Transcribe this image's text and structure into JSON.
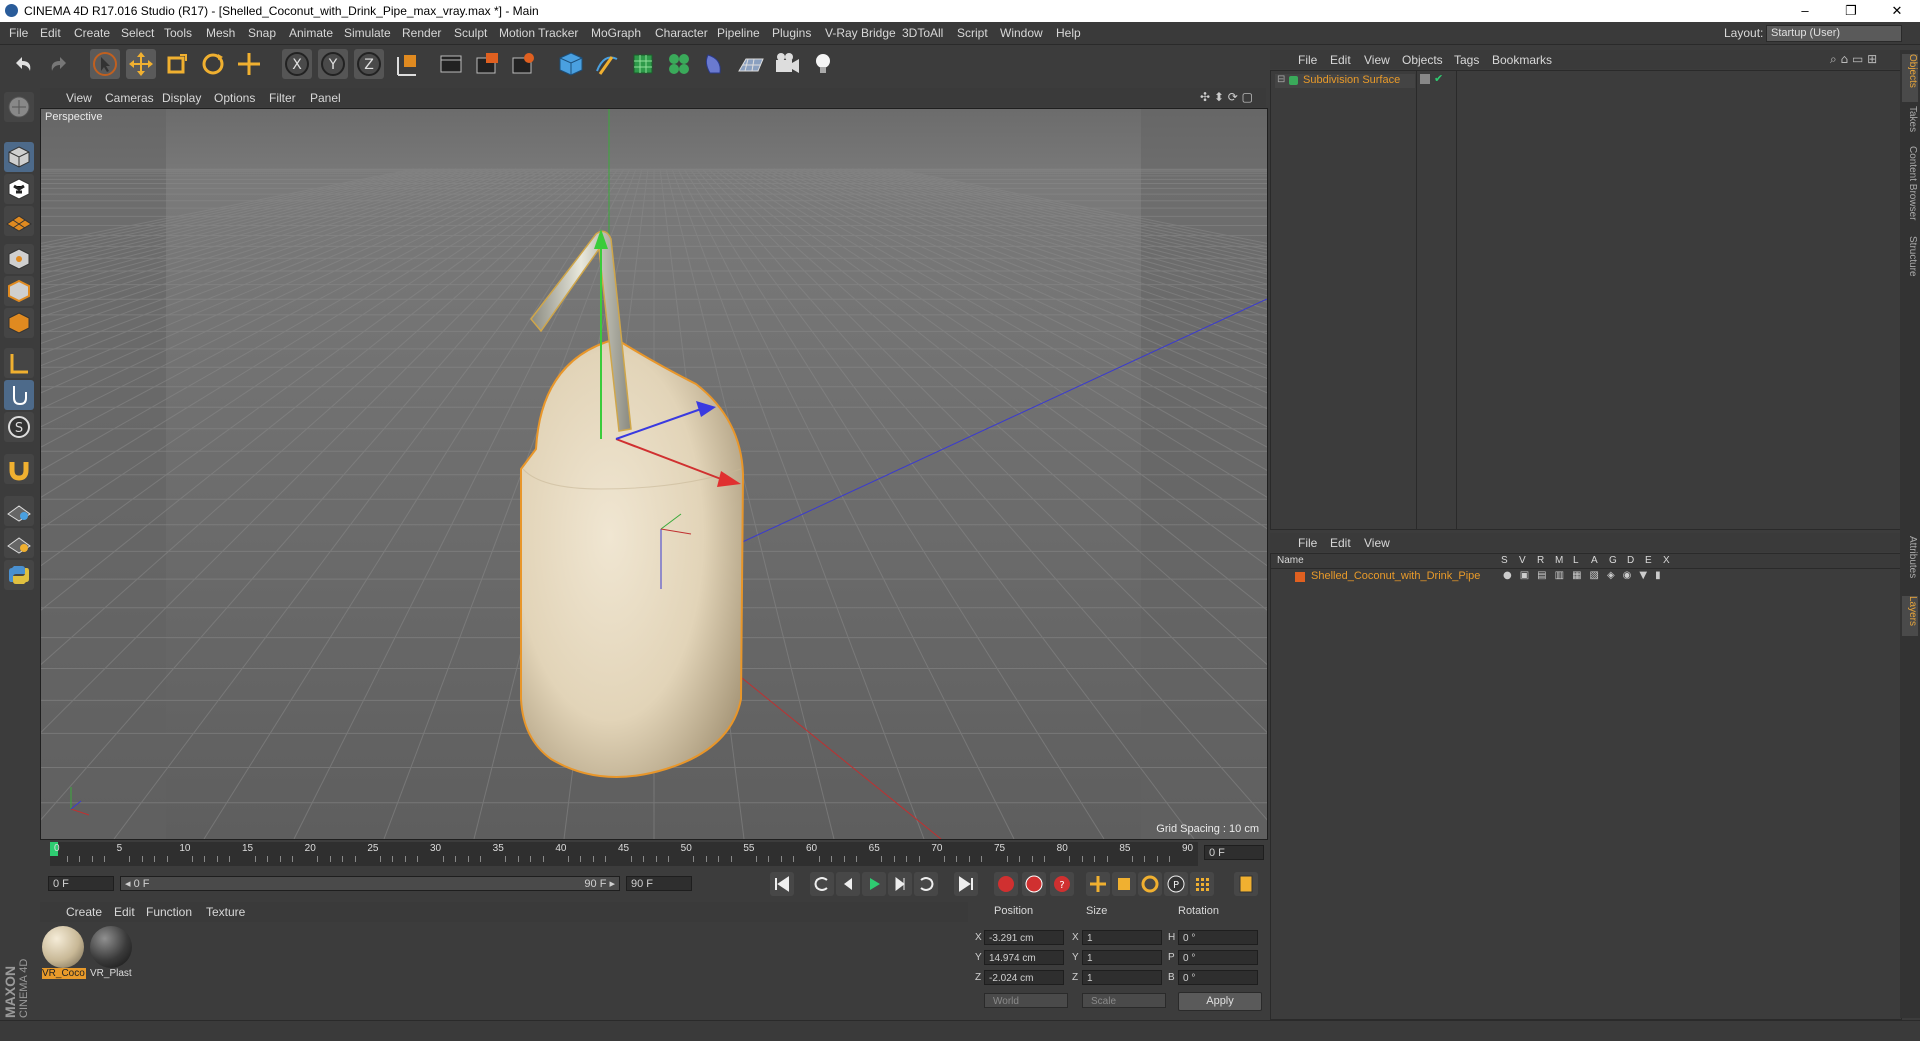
{
  "window": {
    "title": "CINEMA 4D R17.016 Studio (R17) - [Shelled_Coconut_with_Drink_Pipe_max_vray.max *] - Main",
    "minimize": "–",
    "restore": "❐",
    "close": "✕"
  },
  "menubar": {
    "items": [
      "File",
      "Edit",
      "Create",
      "Select",
      "Tools",
      "Mesh",
      "Snap",
      "Animate",
      "Simulate",
      "Render",
      "Sculpt",
      "Motion Tracker",
      "MoGraph",
      "Character",
      "Pipeline",
      "Plugins",
      "V-Ray Bridge",
      "3DToAll",
      "Script",
      "Window",
      "Help"
    ],
    "layout_label": "Layout:",
    "layout_value": "Startup (User)"
  },
  "toolbar": {
    "icons": [
      "undo-icon",
      "redo-icon",
      "select-cursor-icon",
      "move-icon",
      "scale-icon",
      "rotate-icon",
      "move-plus-icon",
      "x-axis-icon",
      "y-axis-icon",
      "z-axis-icon",
      "coordinate-system-icon",
      "render-view-icon",
      "render-picture-viewer-icon",
      "render-settings-icon",
      "cube-icon",
      "pen-spline-icon",
      "subdivision-icon",
      "cloner-icon",
      "deformer-icon",
      "floor-icon",
      "camera-icon",
      "light-icon"
    ]
  },
  "viewport": {
    "menus": [
      "View",
      "Cameras",
      "Display",
      "Options",
      "Filter",
      "Panel"
    ],
    "label": "Perspective",
    "grid_spacing": "Grid Spacing : 10 cm"
  },
  "timeline": {
    "ticks": [
      "0",
      "5",
      "10",
      "15",
      "20",
      "25",
      "30",
      "35",
      "40",
      "45",
      "50",
      "55",
      "60",
      "65",
      "70",
      "75",
      "80",
      "85",
      "90"
    ],
    "end_field": "0 F",
    "start_frame": "0 F",
    "range_start": "◂ 0 F",
    "range_end": "90 F ▸",
    "end_frame": "90 F"
  },
  "materials": {
    "menus": [
      "Create",
      "Edit",
      "Function",
      "Texture"
    ],
    "items": [
      {
        "name": "VR_Coco",
        "color": "#d8c9a8"
      },
      {
        "name": "VR_Plast",
        "color": "#2a2a2a"
      }
    ]
  },
  "coordinates": {
    "headers": [
      "Position",
      "Size",
      "Rotation"
    ],
    "rows": [
      {
        "axis": "X",
        "pos": "-3.291 cm",
        "size_axis": "X",
        "size": "1",
        "rot_axis": "H",
        "rot": "0 °"
      },
      {
        "axis": "Y",
        "pos": "14.974 cm",
        "size_axis": "Y",
        "size": "1",
        "rot_axis": "P",
        "rot": "0 °"
      },
      {
        "axis": "Z",
        "pos": "-2.024 cm",
        "size_axis": "Z",
        "size": "1",
        "rot_axis": "B",
        "rot": "0 °"
      }
    ],
    "mode": "World",
    "size_mode": "Scale",
    "apply": "Apply"
  },
  "objects_panel": {
    "menus": [
      "File",
      "Edit",
      "View",
      "Objects",
      "Tags",
      "Bookmarks"
    ],
    "object_name": "Subdivision Surface"
  },
  "layers_panel": {
    "menus": [
      "File",
      "Edit",
      "View"
    ],
    "columns": [
      "Name",
      "S",
      "V",
      "R",
      "M",
      "L",
      "A",
      "G",
      "D",
      "E",
      "X"
    ],
    "layer_name": "Shelled_Coconut_with_Drink_Pipe"
  },
  "side_tabs": [
    "Objects",
    "Takes",
    "Content Browser",
    "Structure",
    "Attributes",
    "Layers"
  ],
  "logo": {
    "line1": "MAXON",
    "line2": "CINEMA 4D"
  },
  "colors": {
    "accent": "#e89a2a",
    "bg": "#3c3c3c",
    "viewport": "#6a6a6a"
  }
}
